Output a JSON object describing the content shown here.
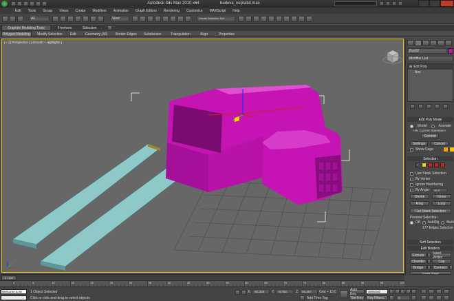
{
  "titlebar": {
    "title": "Autodesk 3ds Max  2010 x64",
    "file": "budova_nepratel.max",
    "search_placeholder": "Type a keyword or phrase"
  },
  "menu": [
    "Edit",
    "Tools",
    "Group",
    "Views",
    "Create",
    "Modifiers",
    "Animation",
    "Graph Editors",
    "Rendering",
    "Customize",
    "MAXScript",
    "Help"
  ],
  "toolbar": {
    "selection_filter": "All",
    "coordinate_system": "View",
    "named_selection": "Create Selection Set"
  },
  "ribbon": {
    "tabs": [
      "Graphite Modeling Tools",
      "Freeform",
      "Selection"
    ],
    "subtabs": [
      "Polygon Modeling",
      "Modify Selection",
      "Edit",
      "Geometry (All)",
      "Border Edges",
      "Subdivision",
      "Triangulation",
      "Align",
      "Properties"
    ]
  },
  "viewport": {
    "label": "[ + ] [ Perspective ] [ Smooth + Highlights ]"
  },
  "panel": {
    "object_name": "Box02",
    "modifier_list": "Modifier List",
    "stack": [
      "Edit Poly",
      "Box"
    ],
    "edit_poly_mode": {
      "title": "Edit Poly Mode",
      "model": "Model",
      "animate": "Animate",
      "current_op": "<No Current Operation>",
      "commit": "Commit",
      "settings": "Settings",
      "cancel": "Cancel",
      "show_cage": "Show Cage"
    },
    "selection": {
      "title": "Selection",
      "use_stack": "Use Stack Selection",
      "by_vertex": "By Vertex",
      "ignore_backfacing": "Ignore Backfacing",
      "by_angle": "By Angle:",
      "angle_value": "45.0",
      "shrink": "Shrink",
      "grow": "Grow",
      "ring": "Ring",
      "loop": "Loop",
      "get_stack": "Get Stack Selection",
      "preview": "Preview Selection",
      "off": "Off",
      "subobj": "SubObj",
      "multi": "Multi",
      "status": "177 Edges Selected"
    },
    "soft_selection": "Soft Selection",
    "edit_borders": {
      "title": "Edit Borders",
      "extrude": "Extrude",
      "insert_vertex": "Insert Vertex",
      "chamfer": "Chamfer",
      "cap": "Cap",
      "bridge": "Bridge",
      "connect": "Connect",
      "create_shape": "Create Shape",
      "weight": "Weight:",
      "edit_tri": "Edit Tri.",
      "turn": "Turn"
    }
  },
  "timeline": {
    "frame": "0 / 100",
    "ticks": [
      "0",
      "5",
      "10",
      "15",
      "20",
      "25",
      "30",
      "35",
      "40",
      "45",
      "50",
      "55",
      "60",
      "65",
      "70",
      "75",
      "80",
      "85",
      "90",
      "95",
      "100"
    ]
  },
  "status": {
    "welcome": "Welcome to M",
    "selected": "1 Object Selected",
    "prompt": "Click or click-and-drag to select objects",
    "x_label": "X:",
    "x": "-61,335",
    "y_label": "Y:",
    "y": "-6,753",
    "z_label": "Z:",
    "z": "55,307",
    "grid": "Grid = 10,0",
    "auto_key": "Auto Key",
    "selected_dd": "Selected",
    "set_key": "Set Key",
    "key_filters": "Key Filters...",
    "add_time_tag": "Add Time Tag",
    "frame_field": "0"
  },
  "colors": {
    "object": "#c513b4",
    "planks": "#8ec9c7",
    "viewport": "#666666",
    "accent_red": "#cc2222",
    "accent_yellow": "#f5d400"
  }
}
